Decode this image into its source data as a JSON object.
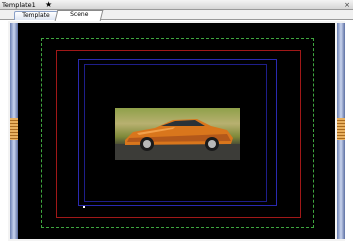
{
  "window": {
    "title": "Template1",
    "pin_icon": "★",
    "close_icon": "×"
  },
  "tabs": [
    {
      "label": "Template",
      "active": false
    },
    {
      "label": "Scene",
      "active": true
    }
  ],
  "canvas": {
    "background": "#000000",
    "guides": {
      "title_safe_color": "#3fa63f",
      "action_safe_color": "#a01818",
      "outer_color": "#2a2ab0",
      "inner_color": "#1e1e8a"
    },
    "image": {
      "subject": "orange sports car"
    }
  },
  "rail_color": "#8a9bd0"
}
